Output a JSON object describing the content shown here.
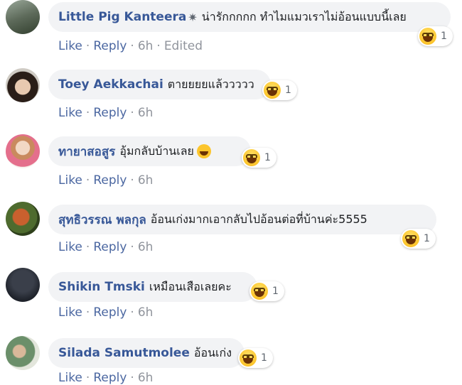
{
  "comments": [
    {
      "name": "Little Pig Kanteera",
      "text": "น่ารักกกกก ทำไมแมวเราไม่อ้อนแบบนี้เลย",
      "reaction_count": "1",
      "like": "Like",
      "reply": "Reply",
      "time": "6h",
      "edited": "Edited"
    },
    {
      "name": "Toey Aekkachai",
      "text": "ตายยยยแล้ววววว",
      "reaction_count": "1",
      "like": "Like",
      "reply": "Reply",
      "time": "6h"
    },
    {
      "name": "ทายาสอสูร",
      "text": "อุ้มกลับบ้านเลย",
      "reaction_count": "1",
      "like": "Like",
      "reply": "Reply",
      "time": "6h"
    },
    {
      "name": "สุทธิวรรณ พลกุล",
      "text": "อ้อนเก่งมากเอากลับไปอ้อนต่อที่บ้านค่ะ5555",
      "reaction_count": "1",
      "like": "Like",
      "reply": "Reply",
      "time": "6h"
    },
    {
      "name": "Shikin Tmski",
      "text": "เหมือนเสือเลยคะ",
      "reaction_count": "1",
      "like": "Like",
      "reply": "Reply",
      "time": "6h"
    },
    {
      "name": "Silada Samutmolee",
      "text": "อ้อนเก่ง",
      "reaction_count": "1",
      "like": "Like",
      "reply": "Reply",
      "time": "6h"
    }
  ],
  "icons": {
    "reaction": "haha-reaction-icon",
    "badge": "top-fan-badge-icon",
    "laugh_emoji": "laughing-emoji-icon"
  },
  "colors": {
    "name": "#385898",
    "bubble": "#f2f3f5",
    "meta": "#90949c"
  }
}
